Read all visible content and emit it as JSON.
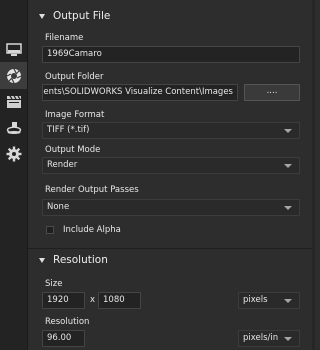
{
  "output_file": {
    "title": "Output File",
    "filename_label": "Filename",
    "filename_value": "1969Camaro",
    "output_folder_label": "Output Folder",
    "output_folder_value": "C:\\Users\\Documents\\SOLIDWORKS Visualize Content\\Images",
    "browse_label": "....",
    "image_format_label": "Image Format",
    "image_format_value": "TIFF (*.tif)",
    "output_mode_label": "Output Mode",
    "output_mode_value": "Render",
    "passes_label": "Render Output Passes",
    "passes_value": "None",
    "include_alpha_label": "Include Alpha",
    "include_alpha_checked": false
  },
  "resolution": {
    "title": "Resolution",
    "size_label": "Size",
    "width": "1920",
    "times": "x",
    "height": "1080",
    "size_unit": "pixels",
    "resolution_label": "Resolution",
    "resolution_value": "96.00",
    "resolution_unit": "pixels/in"
  },
  "sidebar": {
    "icons": [
      "monitor-icon",
      "camera-aperture-icon",
      "film-clapper-icon",
      "turntable-icon",
      "gear-icon"
    ],
    "active_index": 1
  },
  "colors": {
    "panel_bg": "#2d2d2d",
    "sidebar_bg": "#232323",
    "field_bg": "#232323",
    "text": "#e6e6e6"
  }
}
